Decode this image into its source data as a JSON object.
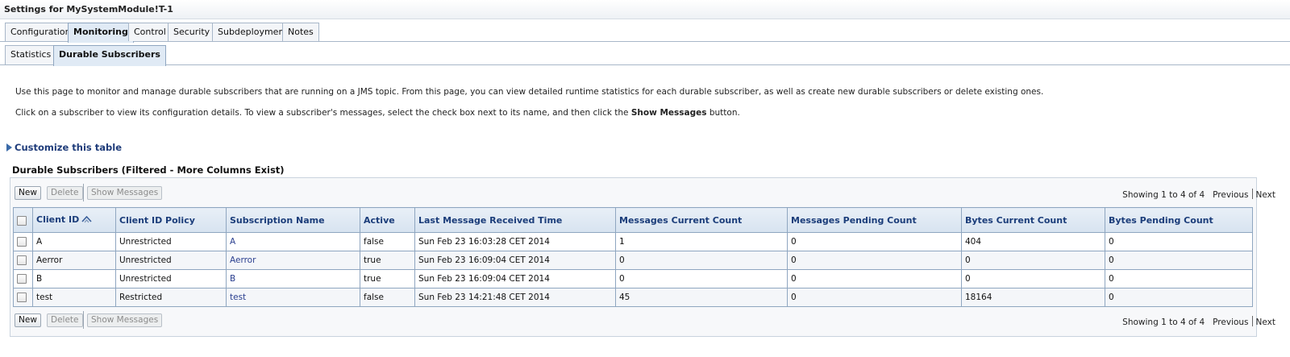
{
  "window": {
    "title": "Settings for MySystemModule!T-1"
  },
  "main_tabs": [
    {
      "label": "Configuration"
    },
    {
      "label": "Monitoring",
      "active": true
    },
    {
      "label": "Control"
    },
    {
      "label": "Security"
    },
    {
      "label": "Subdeployment"
    },
    {
      "label": "Notes"
    }
  ],
  "sub_tabs": [
    {
      "label": "Statistics"
    },
    {
      "label": "Durable Subscribers",
      "active": true
    }
  ],
  "description": {
    "line1": "Use this page to monitor and manage durable subscribers that are running on a JMS topic. From this page, you can view detailed runtime statistics for each durable subscriber, as well as create new durable subscribers or delete existing ones.",
    "line2_prefix": "Click on a subscriber to view its configuration details. To view a subscriber's messages, select the check box next to its name, and then click the ",
    "line2_bold": "Show Messages",
    "line2_suffix": " button."
  },
  "customize_label": "Customize this table",
  "table": {
    "title": "Durable Subscribers (Filtered - More Columns Exist)",
    "buttons": {
      "new": "New",
      "delete": "Delete",
      "show_messages": "Show Messages"
    },
    "paging": {
      "showing": "Showing 1 to 4 of 4",
      "previous": "Previous",
      "next": "Next"
    },
    "columns": [
      "Client ID",
      "Client ID Policy",
      "Subscription Name",
      "Active",
      "Last Message Received Time",
      "Messages Current Count",
      "Messages Pending Count",
      "Bytes Current Count",
      "Bytes Pending Count"
    ],
    "rows": [
      [
        "A",
        "Unrestricted",
        "A",
        "false",
        "Sun Feb 23 16:03:28 CET 2014",
        "1",
        "0",
        "404",
        "0"
      ],
      [
        "Aerror",
        "Unrestricted",
        "Aerror",
        "true",
        "Sun Feb 23 16:09:04 CET 2014",
        "0",
        "0",
        "0",
        "0"
      ],
      [
        "B",
        "Unrestricted",
        "B",
        "true",
        "Sun Feb 23 16:09:04 CET 2014",
        "0",
        "0",
        "0",
        "0"
      ],
      [
        "test",
        "Restricted",
        "test",
        "false",
        "Sun Feb 23 14:21:48 CET 2014",
        "45",
        "0",
        "18164",
        "0"
      ]
    ]
  }
}
